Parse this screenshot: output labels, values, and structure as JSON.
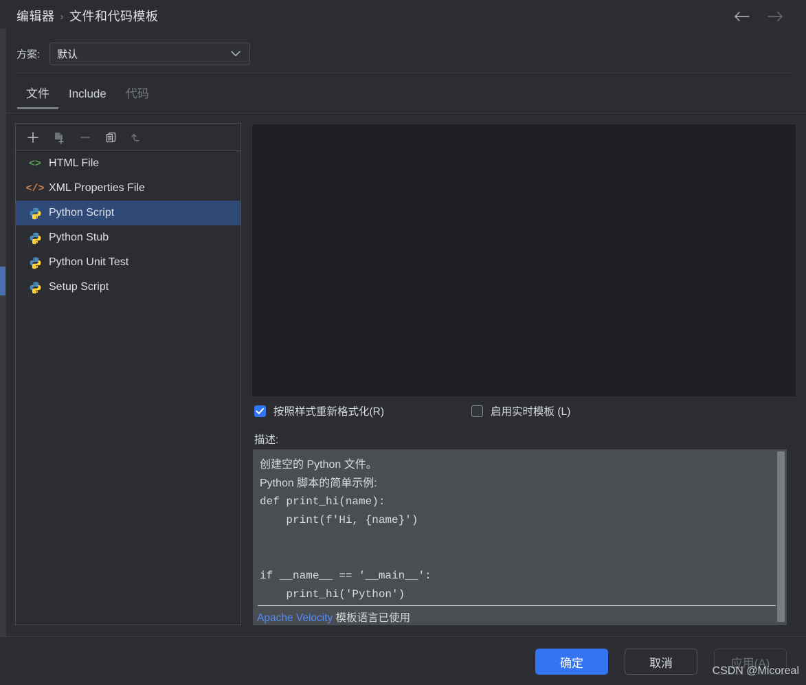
{
  "breadcrumb": {
    "root": "编辑器",
    "separator": "›",
    "current": "文件和代码模板"
  },
  "nav": {
    "back_icon": "arrow-left-icon",
    "forward_icon": "arrow-right-icon"
  },
  "scheme": {
    "label": "方案:",
    "value": "默认",
    "options": [
      "默认"
    ],
    "chevron_icon": "chevron-down-icon"
  },
  "tabs": [
    {
      "label": "文件",
      "active": true,
      "dim": false
    },
    {
      "label": "Include",
      "active": false,
      "dim": false
    },
    {
      "label": "代码",
      "active": false,
      "dim": true
    }
  ],
  "list_toolbar": [
    {
      "name": "add-template-button",
      "icon": "plus-icon",
      "enabled": true
    },
    {
      "name": "create-from-file-button",
      "icon": "file-add-icon",
      "enabled": false
    },
    {
      "name": "remove-template-button",
      "icon": "minus-icon",
      "enabled": false
    },
    {
      "name": "copy-template-button",
      "icon": "copy-icon",
      "enabled": true
    },
    {
      "name": "reset-template-button",
      "icon": "revert-arrow-icon",
      "enabled": false
    }
  ],
  "templates": [
    {
      "label": "HTML File",
      "icon": "html-code-icon",
      "selected": false
    },
    {
      "label": "XML Properties File",
      "icon": "xml-code-icon",
      "selected": false
    },
    {
      "label": "Python Script",
      "icon": "python-icon",
      "selected": true
    },
    {
      "label": "Python Stub",
      "icon": "python-icon",
      "selected": false
    },
    {
      "label": "Python Unit Test",
      "icon": "python-icon",
      "selected": false
    },
    {
      "label": "Setup Script",
      "icon": "python-icon",
      "selected": false
    }
  ],
  "editor": {
    "content": ""
  },
  "checkboxes": [
    {
      "label": "按照样式重新格式化(R)",
      "checked": true
    },
    {
      "label": "启用实时模板 (L)",
      "checked": false
    }
  ],
  "description": {
    "label": "描述:",
    "lines": [
      {
        "text": "创建空的 Python 文件。",
        "mono": false
      },
      {
        "text": "Python 脚本的简单示例:",
        "mono": false
      },
      {
        "text": "def print_hi(name):",
        "mono": true
      },
      {
        "text": "    print(f'Hi, {name}')",
        "mono": true
      },
      {
        "text": "",
        "mono": true
      },
      {
        "text": "",
        "mono": true
      },
      {
        "text": "if __name__ == '__main__':",
        "mono": true
      },
      {
        "text": "    print_hi('Python')",
        "mono": true
      }
    ],
    "note_link": "Apache Velocity",
    "note_text": " 模板语言已使用"
  },
  "footer": {
    "ok": "确定",
    "cancel": "取消",
    "apply": "应用(A)"
  },
  "watermark": "CSDN @Micoreal",
  "colors": {
    "accent": "#3574f0",
    "selection": "#2f4a77",
    "link": "#548af7",
    "background": "#2b2d30",
    "editor_background": "#1e1f22",
    "description_background": "#4a4d51",
    "html_icon": "#5a9e5a",
    "xml_icon": "#cf7d4a"
  }
}
